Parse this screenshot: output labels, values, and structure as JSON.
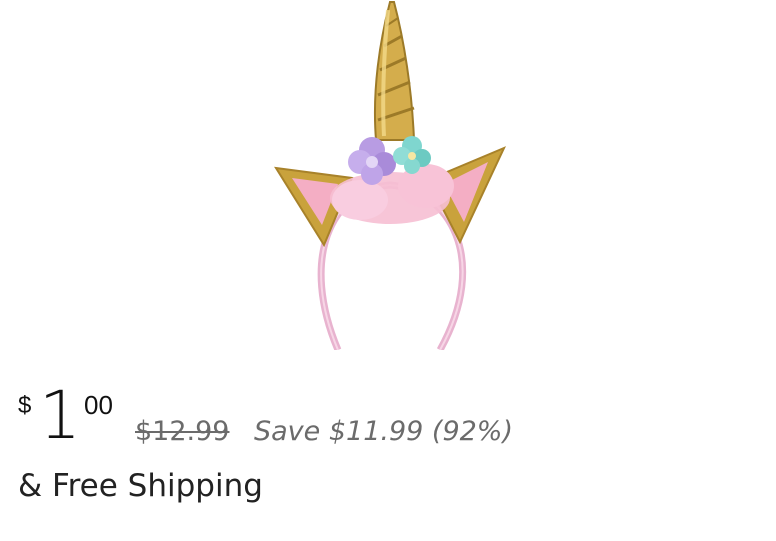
{
  "product": {
    "image_alt": "unicorn-headband-image"
  },
  "price": {
    "currency_symbol": "$",
    "whole": "1",
    "fraction": "00",
    "list_price": "$12.99",
    "savings": "Save $11.99 (92%)"
  },
  "shipping": {
    "label": "& Free Shipping"
  },
  "colors": {
    "gold": "#c9a23c",
    "pink": "#f4b6c8",
    "lavender": "#b79be0",
    "mint": "#7fd6cf",
    "headband": "#e9b8d3",
    "strike_text": "#6b6b6b"
  }
}
